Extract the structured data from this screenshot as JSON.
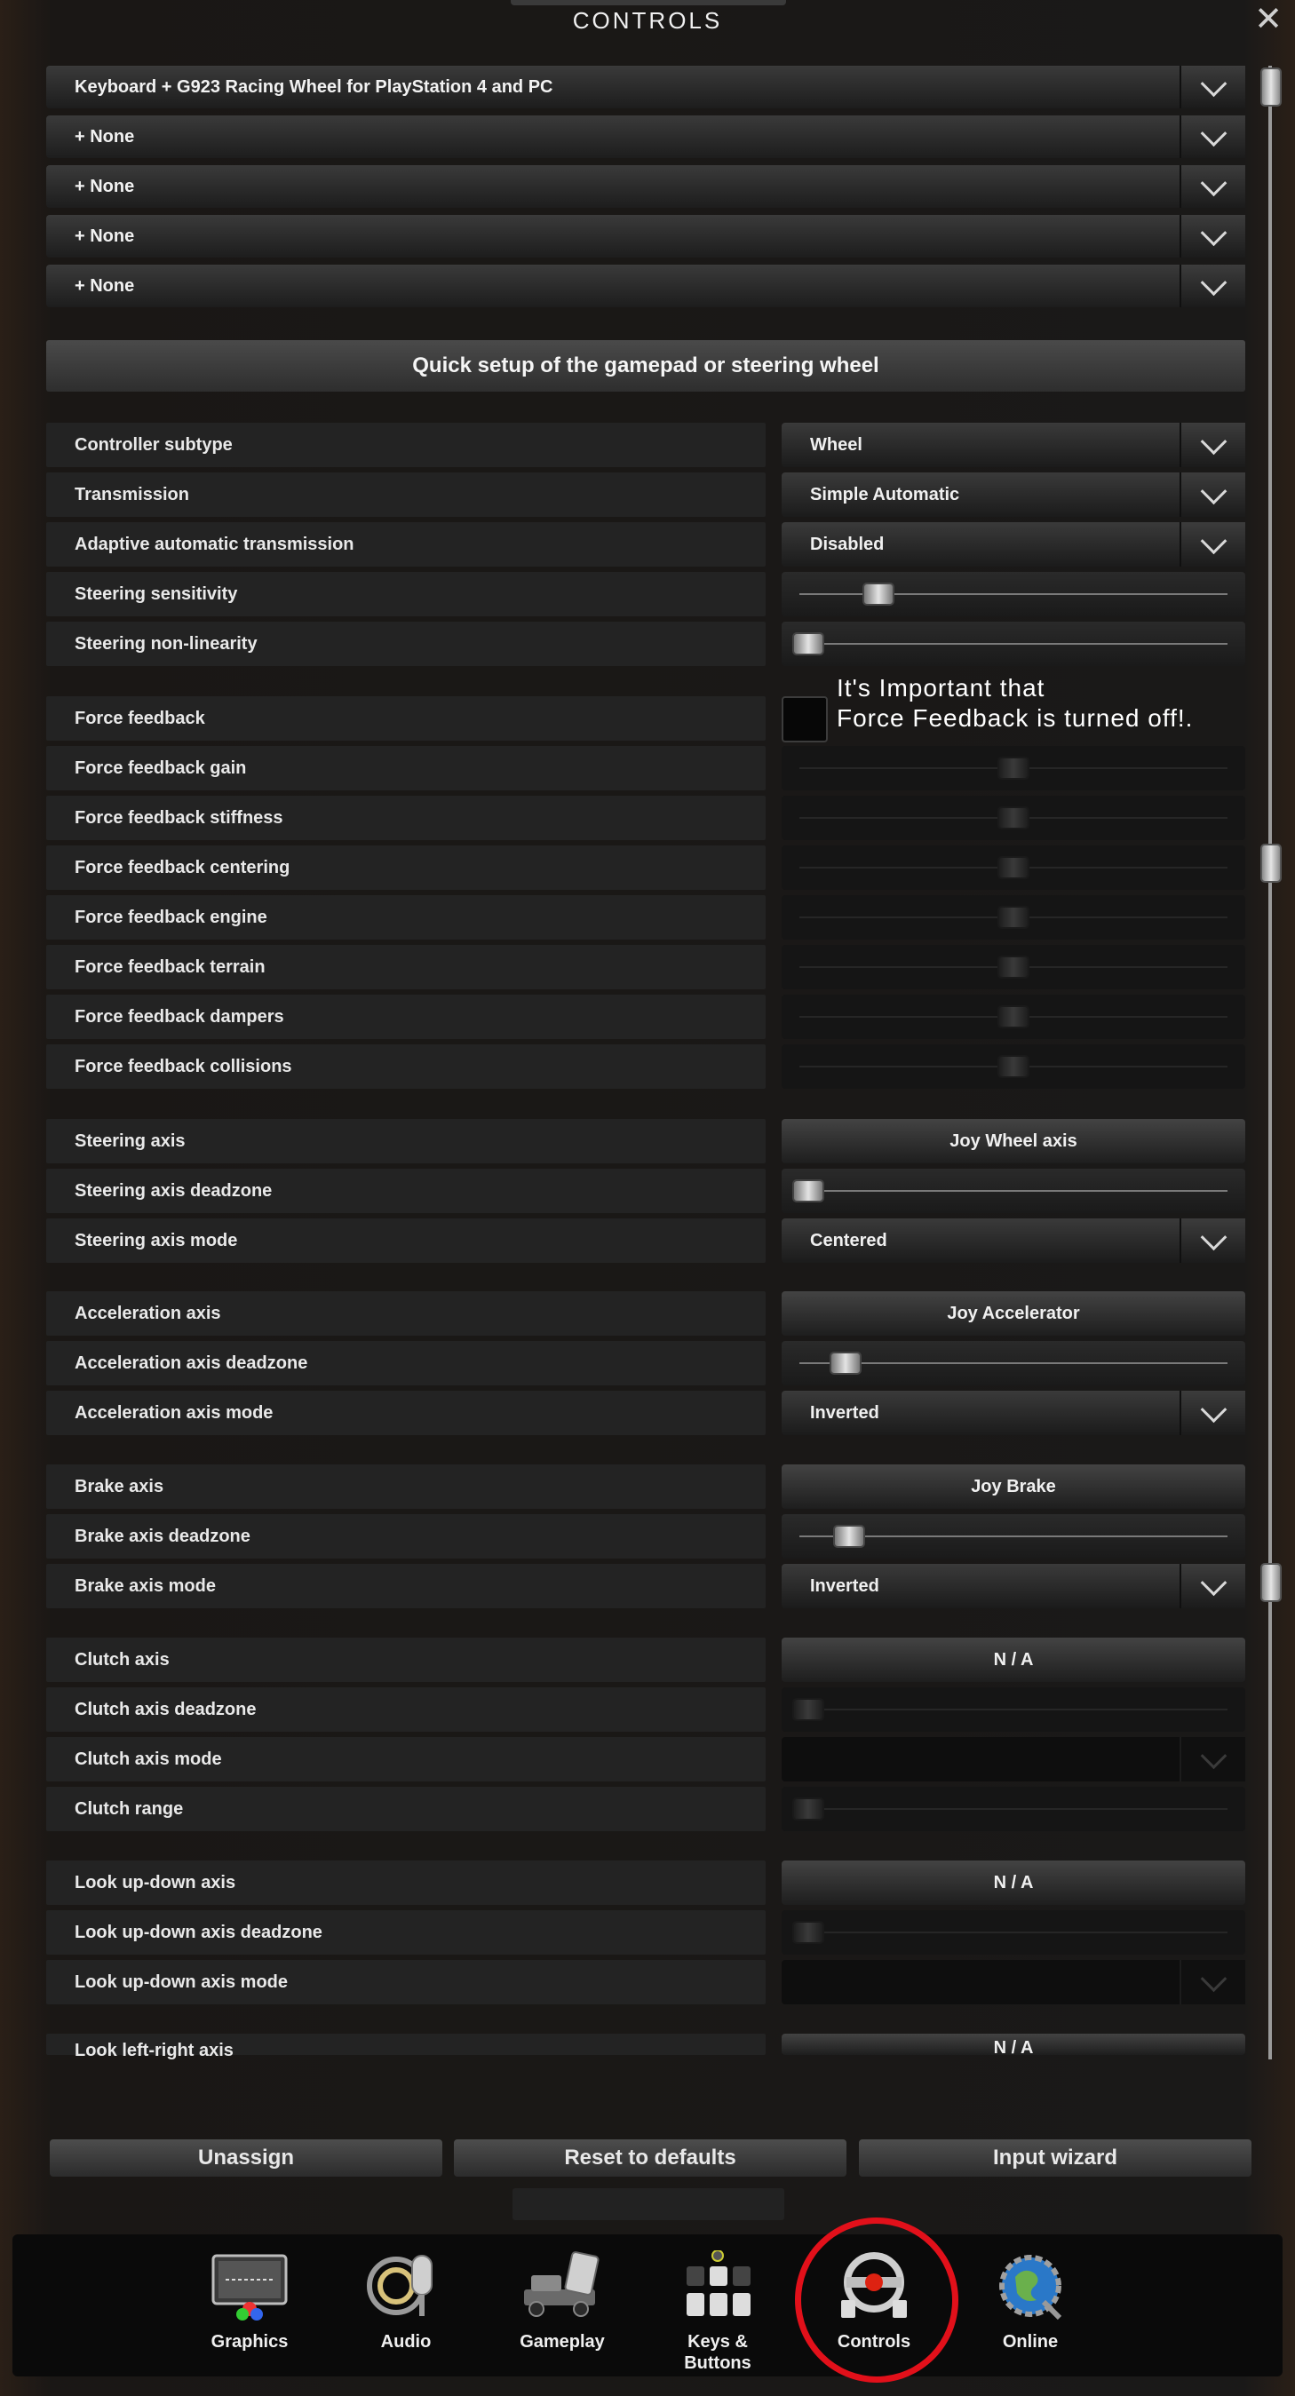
{
  "window": {
    "title": "CONTROLS",
    "close_icon": "close-icon"
  },
  "devices": [
    "Keyboard + G923 Racing Wheel for PlayStation 4 and PC",
    "+ None",
    "+ None",
    "+ None",
    "+ None"
  ],
  "quick_setup": "Quick setup of the gamepad or steering wheel",
  "rows": {
    "controller_subtype": {
      "label": "Controller subtype",
      "value": "Wheel"
    },
    "transmission": {
      "label": "Transmission",
      "value": "Simple Automatic"
    },
    "adaptive": {
      "label": "Adaptive automatic transmission",
      "value": "Disabled"
    },
    "steering_sensitivity": {
      "label": "Steering sensitivity",
      "level": 0.17
    },
    "steering_nonlinearity": {
      "label": "Steering non-linearity",
      "level": 0.0
    },
    "force_feedback": {
      "label": "Force feedback",
      "checked": false
    },
    "ff_gain": {
      "label": "Force feedback gain",
      "level": 0.5
    },
    "ff_stiffness": {
      "label": "Force feedback stiffness",
      "level": 0.5
    },
    "ff_centering": {
      "label": "Force feedback centering",
      "level": 0.5
    },
    "ff_engine": {
      "label": "Force feedback engine",
      "level": 0.5
    },
    "ff_terrain": {
      "label": "Force feedback terrain",
      "level": 0.5
    },
    "ff_dampers": {
      "label": "Force feedback dampers",
      "level": 0.5
    },
    "ff_collisions": {
      "label": "Force feedback collisions",
      "level": 0.5
    },
    "steering_axis": {
      "label": "Steering axis",
      "value": "Joy Wheel axis"
    },
    "steering_deadzone": {
      "label": "Steering axis deadzone",
      "level": 0.0
    },
    "steering_mode": {
      "label": "Steering axis mode",
      "value": "Centered"
    },
    "accel_axis": {
      "label": "Acceleration axis",
      "value": "Joy Accelerator"
    },
    "accel_deadzone": {
      "label": "Acceleration axis deadzone",
      "level": 0.09
    },
    "accel_mode": {
      "label": "Acceleration axis mode",
      "value": "Inverted"
    },
    "brake_axis": {
      "label": "Brake axis",
      "value": "Joy Brake"
    },
    "brake_deadzone": {
      "label": "Brake axis deadzone",
      "level": 0.1
    },
    "brake_mode": {
      "label": "Brake axis mode",
      "value": "Inverted"
    },
    "clutch_axis": {
      "label": "Clutch axis",
      "value": "N / A"
    },
    "clutch_deadzone": {
      "label": "Clutch axis deadzone",
      "level": 0.0
    },
    "clutch_mode": {
      "label": "Clutch axis mode",
      "value": ""
    },
    "clutch_range": {
      "label": "Clutch range",
      "level": 0.0
    },
    "look_ud_axis": {
      "label": "Look up-down axis",
      "value": "N / A"
    },
    "look_ud_deadzone": {
      "label": "Look up-down axis deadzone",
      "level": 0.0
    },
    "look_ud_mode": {
      "label": "Look up-down axis mode",
      "value": ""
    },
    "look_lr_axis": {
      "label": "Look left-right axis",
      "value": "N / A"
    }
  },
  "annotation": "It's Important that\nForce Feedback is turned off!.",
  "buttons": {
    "unassign": "Unassign",
    "reset": "Reset to defaults",
    "wizard": "Input wizard"
  },
  "tabs": [
    {
      "label": "Graphics",
      "icon": "monitor-icon"
    },
    {
      "label": "Audio",
      "icon": "microphone-icon"
    },
    {
      "label": "Gameplay",
      "icon": "truck-icon"
    },
    {
      "label": "Keys &\nButtons",
      "icon": "keyboard-icon"
    },
    {
      "label": "Controls",
      "icon": "steering-wheel-icon"
    },
    {
      "label": "Online",
      "icon": "globe-icon"
    }
  ],
  "colors": {
    "highlight": "#e2101a"
  }
}
